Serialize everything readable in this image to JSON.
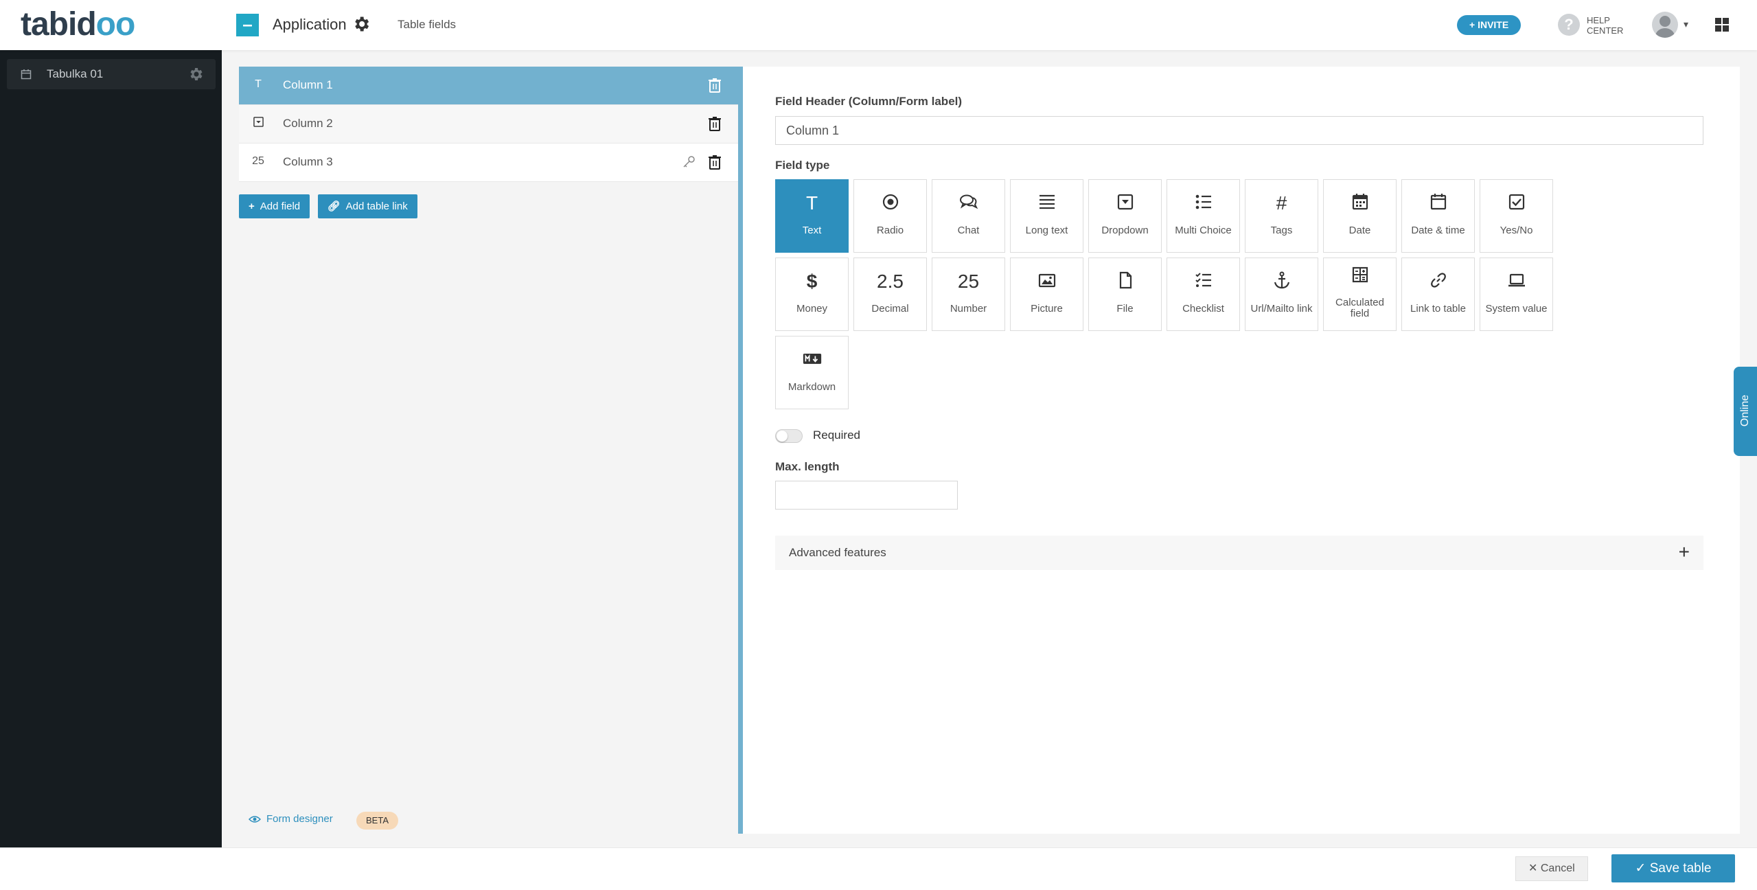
{
  "topbar": {
    "logo_text": "tabid",
    "logo_oo": "oo",
    "app_name": "Application",
    "breadcrumb": "Table fields",
    "invite_label": "+ INVITE",
    "help_line1": "HELP",
    "help_line2": "CENTER"
  },
  "sidebar": {
    "items": [
      {
        "label": "Tabulka 01"
      }
    ]
  },
  "fields": [
    {
      "type_glyph": "T",
      "name": "Column 1",
      "active": true
    },
    {
      "type_glyph": "▾",
      "name": "Column 2",
      "active": false
    },
    {
      "type_glyph": "25",
      "name": "Column 3",
      "active": false
    }
  ],
  "buttons": {
    "add_field": "Add field",
    "add_table_link": "Add table link"
  },
  "form_designer": {
    "label": "Form designer",
    "badge": "BETA"
  },
  "editor": {
    "header_label": "Field Header (Column/Form label)",
    "header_value": "Column 1",
    "field_type_label": "Field type",
    "selected_type": "Text",
    "types": [
      {
        "label": "Text",
        "icon": "text-icon"
      },
      {
        "label": "Radio",
        "icon": "radio-icon"
      },
      {
        "label": "Chat",
        "icon": "chat-icon"
      },
      {
        "label": "Long text",
        "icon": "long-text-icon"
      },
      {
        "label": "Dropdown",
        "icon": "dropdown-icon"
      },
      {
        "label": "Multi Choice",
        "icon": "list-icon"
      },
      {
        "label": "Tags",
        "icon": "hash-icon"
      },
      {
        "label": "Date",
        "icon": "calendar-grid-icon"
      },
      {
        "label": "Date & time",
        "icon": "calendar-icon"
      },
      {
        "label": "Yes/No",
        "icon": "checkbox-icon"
      },
      {
        "label": "Money",
        "icon": "dollar-icon"
      },
      {
        "label": "Decimal",
        "icon": "decimal-icon",
        "glyph": "2.5"
      },
      {
        "label": "Number",
        "icon": "number-icon",
        "glyph": "25"
      },
      {
        "label": "Picture",
        "icon": "picture-icon"
      },
      {
        "label": "File",
        "icon": "file-icon"
      },
      {
        "label": "Checklist",
        "icon": "checklist-icon"
      },
      {
        "label": "Url/Mailto link",
        "icon": "anchor-icon"
      },
      {
        "label": "Calculated field",
        "icon": "calculator-icon"
      },
      {
        "label": "Link to table",
        "icon": "link-icon"
      },
      {
        "label": "System value",
        "icon": "laptop-icon"
      },
      {
        "label": "Markdown",
        "icon": "markdown-icon"
      }
    ],
    "required_label": "Required",
    "required_on": false,
    "max_length_label": "Max. length",
    "max_length_value": "",
    "advanced_label": "Advanced features"
  },
  "online_tab": "Online",
  "footer": {
    "cancel_label": "Cancel",
    "save_label": "Save table"
  },
  "colors": {
    "accent": "#2d8fbd",
    "active_row": "#72b1cf",
    "sidebar_bg": "#161c20"
  }
}
